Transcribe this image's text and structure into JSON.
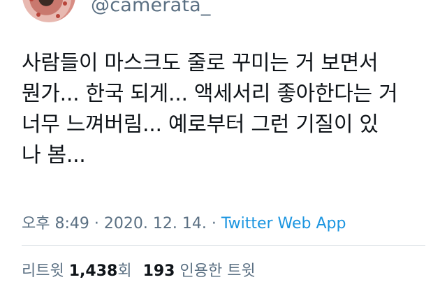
{
  "author": {
    "handle": "@camerata_"
  },
  "tweet": {
    "text": "사람들이 마스크도 줄로 꾸미는 거 보면서\n뭔가... 한국 되게... 액세서리 좋아한다는 거\n너무 느껴버림... 예로부터 그런 기질이 있\n나 봄...",
    "time": "오후 8:49",
    "separator1": " · ",
    "date": "2020. 12. 14.",
    "separator2": " · ",
    "source": "Twitter Web App"
  },
  "stats": {
    "retweets_label": "리트윗 ",
    "retweets_count": "1,438",
    "retweets_suffix": "회",
    "quotes_count": "193",
    "quotes_label": " 인용한 트윗"
  },
  "colors": {
    "text": "#0f1419",
    "secondary": "#5b7083",
    "link": "#1b95e0",
    "divider": "#dfe4e8"
  }
}
